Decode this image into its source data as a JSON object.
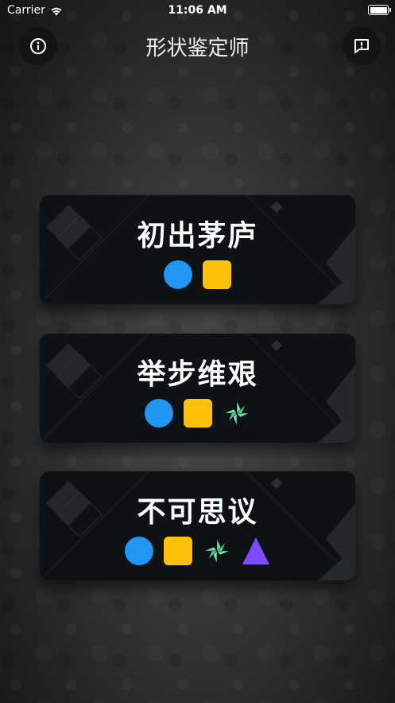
{
  "status": {
    "carrier": "Carrier",
    "time": "11:06 AM"
  },
  "nav": {
    "title": "形状鉴定师",
    "info_icon": "info-icon",
    "feedback_icon": "feedback-icon"
  },
  "levels": [
    {
      "title": "初出茅庐",
      "shapes": [
        "circle",
        "square"
      ]
    },
    {
      "title": "举步维艰",
      "shapes": [
        "circle",
        "square",
        "pinwheel"
      ]
    },
    {
      "title": "不可思议",
      "shapes": [
        "circle",
        "square",
        "pinwheel",
        "triangle"
      ]
    }
  ],
  "colors": {
    "circle": "#2196F3",
    "square": "#FFC107",
    "pinwheel": "#69F0AE",
    "triangle": "#7C4DFF",
    "card": "#0E1214"
  }
}
